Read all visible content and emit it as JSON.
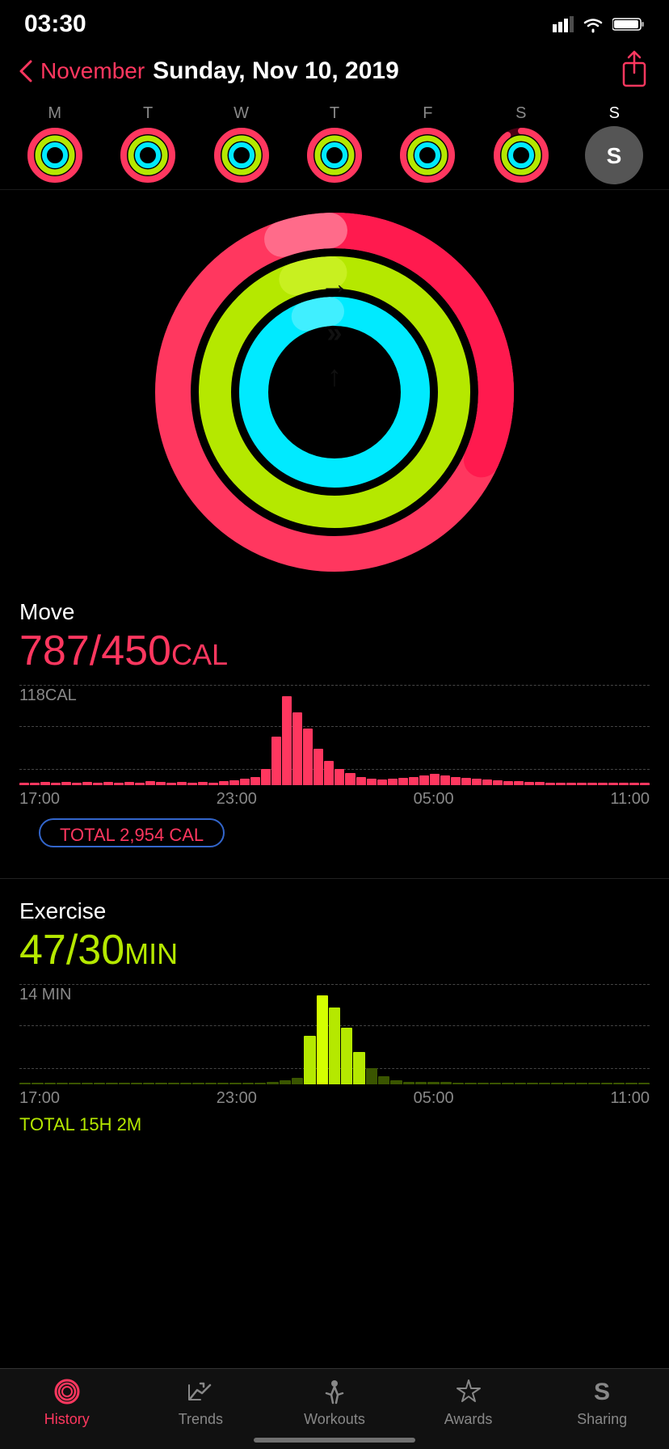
{
  "statusBar": {
    "time": "03:30",
    "icons": [
      "signal",
      "wifi",
      "battery"
    ]
  },
  "nav": {
    "backLabel": "November",
    "title": "Sunday, Nov 10, 2019",
    "shareLabel": "share"
  },
  "weekDays": [
    {
      "label": "M",
      "isToday": false,
      "hasAvatar": false
    },
    {
      "label": "T",
      "isToday": false,
      "hasAvatar": false
    },
    {
      "label": "W",
      "isToday": false,
      "hasAvatar": false
    },
    {
      "label": "T",
      "isToday": false,
      "hasAvatar": false
    },
    {
      "label": "F",
      "isToday": false,
      "hasAvatar": false
    },
    {
      "label": "S",
      "isToday": false,
      "hasAvatar": false
    },
    {
      "label": "S",
      "isToday": true,
      "hasAvatar": true,
      "avatarLetter": "S"
    }
  ],
  "move": {
    "label": "Move",
    "current": "787",
    "goal": "450",
    "unit": "CAL",
    "chartTopLabel": "118CAL",
    "timeLabels": [
      "17:00",
      "23:00",
      "05:00",
      "11:00"
    ],
    "total": "TOTAL 2,954 CAL"
  },
  "exercise": {
    "label": "Exercise",
    "current": "47",
    "goal": "30",
    "unit": "MIN",
    "chartTopLabel": "14 MIN",
    "timeLabels": [
      "17:00",
      "23:00",
      "05:00",
      "11:00"
    ],
    "total": "TOTAL 15H 2M"
  },
  "tabs": [
    {
      "label": "History",
      "active": true
    },
    {
      "label": "Trends",
      "active": false
    },
    {
      "label": "Workouts",
      "active": false
    },
    {
      "label": "Awards",
      "active": false
    },
    {
      "label": "Sharing",
      "active": false
    }
  ],
  "arrows": {
    "outer": "→",
    "middle": "»",
    "inner": "↑"
  }
}
